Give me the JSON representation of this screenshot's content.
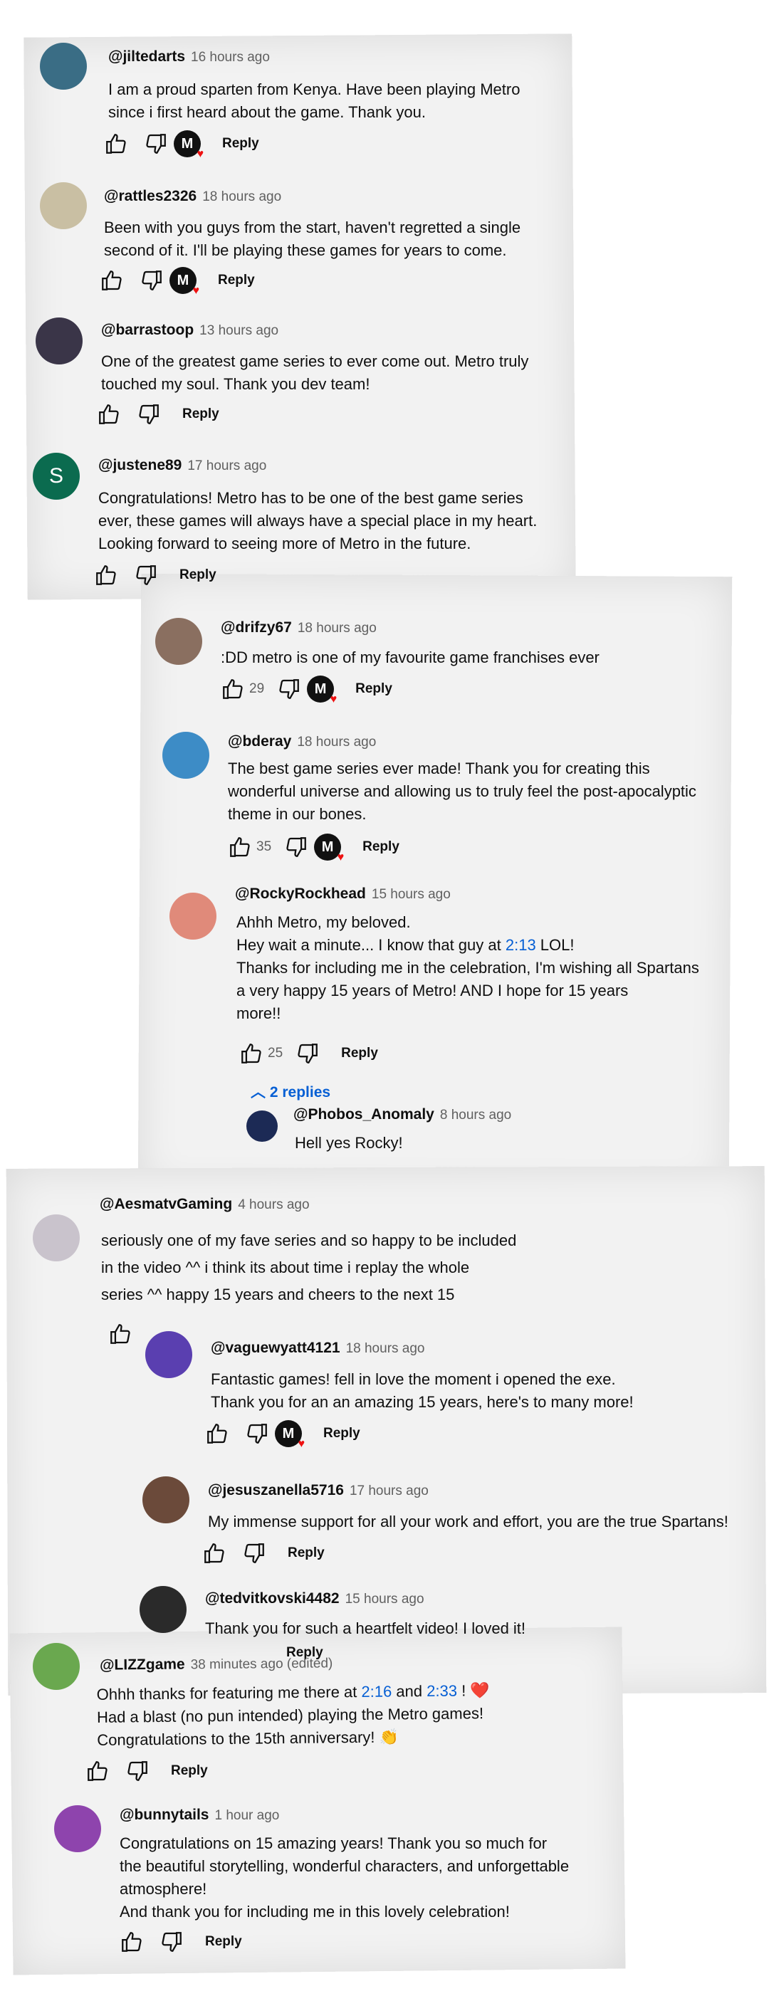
{
  "comments": [
    {
      "handle": "@jiltedarts",
      "time": "16 hours ago",
      "lines": [
        "I am a proud sparten from Kenya. Have been playing Metro",
        "since i first heard about the game. Thank you."
      ],
      "likes": "",
      "reply": "Reply",
      "avatar_color": "#3a6d85"
    },
    {
      "handle": "@rattles2326",
      "time": "18 hours ago",
      "lines": [
        "Been with you guys from the start, haven't regretted a single",
        "second of it. I'll be playing these games for years to come."
      ],
      "likes": "",
      "reply": "Reply",
      "avatar_color": "#c9bfa3"
    },
    {
      "handle": "@barrastoop",
      "time": "13 hours ago",
      "lines": [
        "One of the greatest game series to ever come out. Metro truly",
        "touched my soul. Thank you dev team!"
      ],
      "likes": "",
      "reply": "Reply",
      "avatar_color": "#3a3548"
    },
    {
      "handle": "@justene89",
      "time": "17 hours ago",
      "lines": [
        "Congratulations! Metro has to be one of the best game series",
        "ever, these games will always have a special place in my heart.",
        "Looking forward to seeing more of Metro in the future."
      ],
      "likes": "",
      "reply": "Reply",
      "avatar_color": "#0b6b4f",
      "avatar_letter": "S"
    },
    {
      "handle": "@drifzy67",
      "time": "18 hours ago",
      "lines": [
        ":DD metro is one of my favourite game franchises ever"
      ],
      "likes": "29",
      "reply": "Reply",
      "avatar_color": "#8a6f60"
    },
    {
      "handle": "@bderay",
      "time": "18 hours ago",
      "lines": [
        "The best game series ever made! Thank you for creating this",
        "wonderful universe and allowing us to truly feel the post-apocalyptic",
        "theme in our bones."
      ],
      "likes": "35",
      "reply": "Reply",
      "avatar_color": "#3d8cc6"
    },
    {
      "handle": "@RockyRockhead",
      "time": "15 hours ago",
      "lines": [
        "Ahhh Metro, my beloved.",
        "Hey wait a minute... I know that guy at ",
        "Thanks for including me in the celebration, I'm wishing all Spartans",
        "a very happy 15 years of Metro! AND I hope for 15 years",
        "more!!"
      ],
      "ts1": "2:13",
      "lol": " LOL!",
      "likes": "25",
      "reply": "Reply",
      "avatar_color": "#e08a7a",
      "replies_toggle": "2 replies"
    },
    {
      "handle": "@Phobos_Anomaly",
      "time": "8 hours ago",
      "lines": [
        "Hell yes Rocky!"
      ],
      "avatar_color": "#1c2a55"
    },
    {
      "handle": "@AesmatvGaming",
      "time": "4 hours ago",
      "lines": [
        "seriously one of my fave series and so happy to be included",
        "in the video ^^ i think its about time  i replay the whole",
        "series ^^ happy 15 years and cheers to the next 15"
      ],
      "avatar_color": "#c9c3cc"
    },
    {
      "handle": "@vaguewyatt4121",
      "time": "18 hours ago",
      "lines": [
        "Fantastic games! fell in love the moment i opened the exe.",
        "Thank you for an an amazing 15 years, here's to many more!"
      ],
      "reply": "Reply",
      "avatar_color": "#5a3fb0"
    },
    {
      "handle": "@jesuszanella5716",
      "time": "17 hours ago",
      "lines": [
        "My immense support for all your work and effort, you are the true Spartans!"
      ],
      "reply": "Reply",
      "avatar_color": "#6b4a3a"
    },
    {
      "handle": "@tedvitkovski4482",
      "time": "15 hours ago",
      "lines": [
        "Thank you for such a heartfelt video! I loved it!"
      ],
      "reply": "Reply",
      "avatar_color": "#2a2a2a"
    },
    {
      "handle": "@LIZZgame",
      "time": "38 minutes ago (edited)",
      "line1_a": "Ohhh thanks for featuring me there at ",
      "ts_a": "2:16",
      "line1_b": " and ",
      "ts_b": "2:33",
      "line1_c": " ! ❤️",
      "lines": [
        "Had a blast (no pun intended) playing the Metro games!",
        "Congratulations to the 15th anniversary! 👏"
      ],
      "reply": "Reply",
      "avatar_color": "#6aa84f"
    },
    {
      "handle": "@bunnytails",
      "time": "1 hour ago",
      "lines": [
        "Congratulations on 15 amazing years! Thank you so much for",
        "the beautiful storytelling, wonderful characters, and unforgettable",
        "atmosphere!",
        "And thank you for including me in this lovely celebration!"
      ],
      "reply": "Reply",
      "avatar_color": "#8e44ad"
    }
  ],
  "icons": {
    "like": "thumbs-up-icon",
    "dislike": "thumbs-down-icon",
    "heart": "creator-heart-icon",
    "chevron": "chevron-up-icon"
  },
  "colors": {
    "link": "#065fd4",
    "handle": "#0f0f0f",
    "muted": "#606060"
  }
}
